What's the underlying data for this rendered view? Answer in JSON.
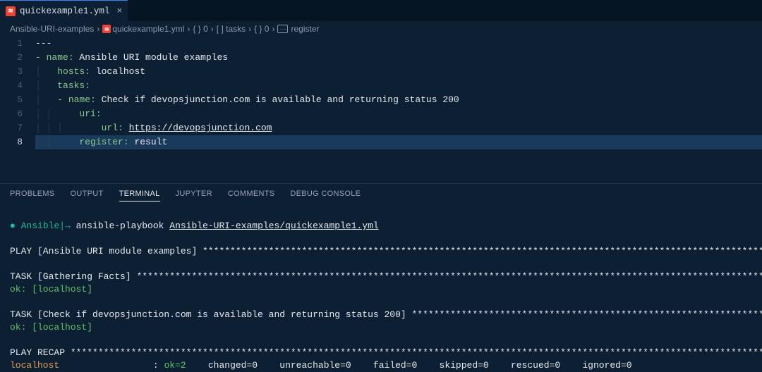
{
  "tab": {
    "name": "quickexample1.yml"
  },
  "breadcrumb": {
    "root": "Ansible-URI-examples",
    "file": "quickexample1.yml",
    "seg1": "{ } 0",
    "seg2": "[ ] tasks",
    "seg3": "{ } 0",
    "register_badge": "···",
    "seg4": "register"
  },
  "code": {
    "lines": [
      "1",
      "2",
      "3",
      "4",
      "5",
      "6",
      "7",
      "8"
    ],
    "l1": "---",
    "l2_key": "- name",
    "l2_colon": ": ",
    "l2_val": "Ansible URI module examples",
    "l3_key": "  hosts",
    "l3_colon": ": ",
    "l3_val": "localhost",
    "l4_key": "  tasks",
    "l4_colon": ":",
    "l5_key": "  - name",
    "l5_colon": ": ",
    "l5_val": "Check if devopsjunction.com is available and returning status 200",
    "l6_key": "    uri",
    "l6_colon": ":",
    "l7_key": "      url",
    "l7_colon": ": ",
    "l7_val": "https://devopsjunction.com",
    "l8_key": "    register",
    "l8_colon": ": ",
    "l8_val": "result"
  },
  "panel_tabs": {
    "problems": "PROBLEMS",
    "output": "OUTPUT",
    "terminal": "TERMINAL",
    "jupyter": "JUPYTER",
    "comments": "COMMENTS",
    "debug": "DEBUG CONSOLE"
  },
  "terminal": {
    "prompt_prefix": "●",
    "prompt_ansible": "Ansible",
    "prompt_sep": "|→ ",
    "cmd1": "ansible-playbook ",
    "cmd2": "Ansible-URI-examples/quickexample1.yml",
    "play": "PLAY [Ansible URI module examples] ",
    "task1": "TASK [Gathering Facts] ",
    "ok": "ok: [localhost]",
    "task2": "TASK [Check if devopsjunction.com is available and returning status 200] ",
    "recap": "PLAY RECAP ",
    "recap_host": "localhost",
    "recap_colon": "                 : ",
    "recap_ok": "ok=2   ",
    "recap_rest": " changed=0    unreachable=0    failed=0    skipped=0    rescued=0    ignored=0   ",
    "stars_long": "*********************************************************************************************************************",
    "stars_med": "*********************************************************************************************************************************",
    "stars_short": "******************************************************************************",
    "stars_recap": "*****************************************************************************************************************************************"
  }
}
